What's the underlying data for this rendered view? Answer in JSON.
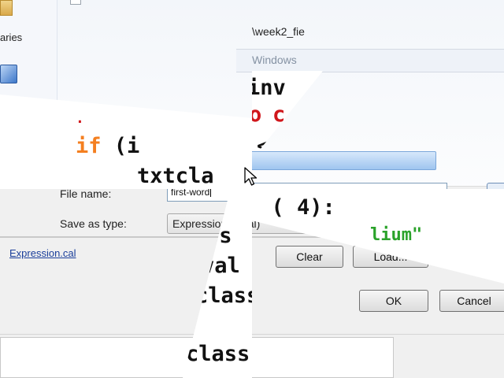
{
  "explorer": {
    "sidebar_label": "aries",
    "path_fragment": "\\week2_fie",
    "breadcrumb": "Windows",
    "filename_label": "File name:",
    "filename_value": "first-word",
    "type_label": "Save as type:",
    "type_value": "Expressions (.cal)"
  },
  "expression_dialog": {
    "link": "Expression.cal",
    "buttons": {
      "clear": "Clear",
      "load": "Load...",
      "ok": "OK",
      "cancel": "Cancel"
    }
  },
  "code": {
    "line1": "inv",
    "line2_kw": "if",
    "line2_rest": " (i",
    "line2_sym": "<",
    "line3": "txtcla",
    "line4": "( 4):",
    "line5_str": "lium\"",
    "line6": "ss",
    "line7": "val",
    "line8": "class",
    "line9": "class",
    "red_mark1": "o",
    "red_mark2": "c"
  }
}
